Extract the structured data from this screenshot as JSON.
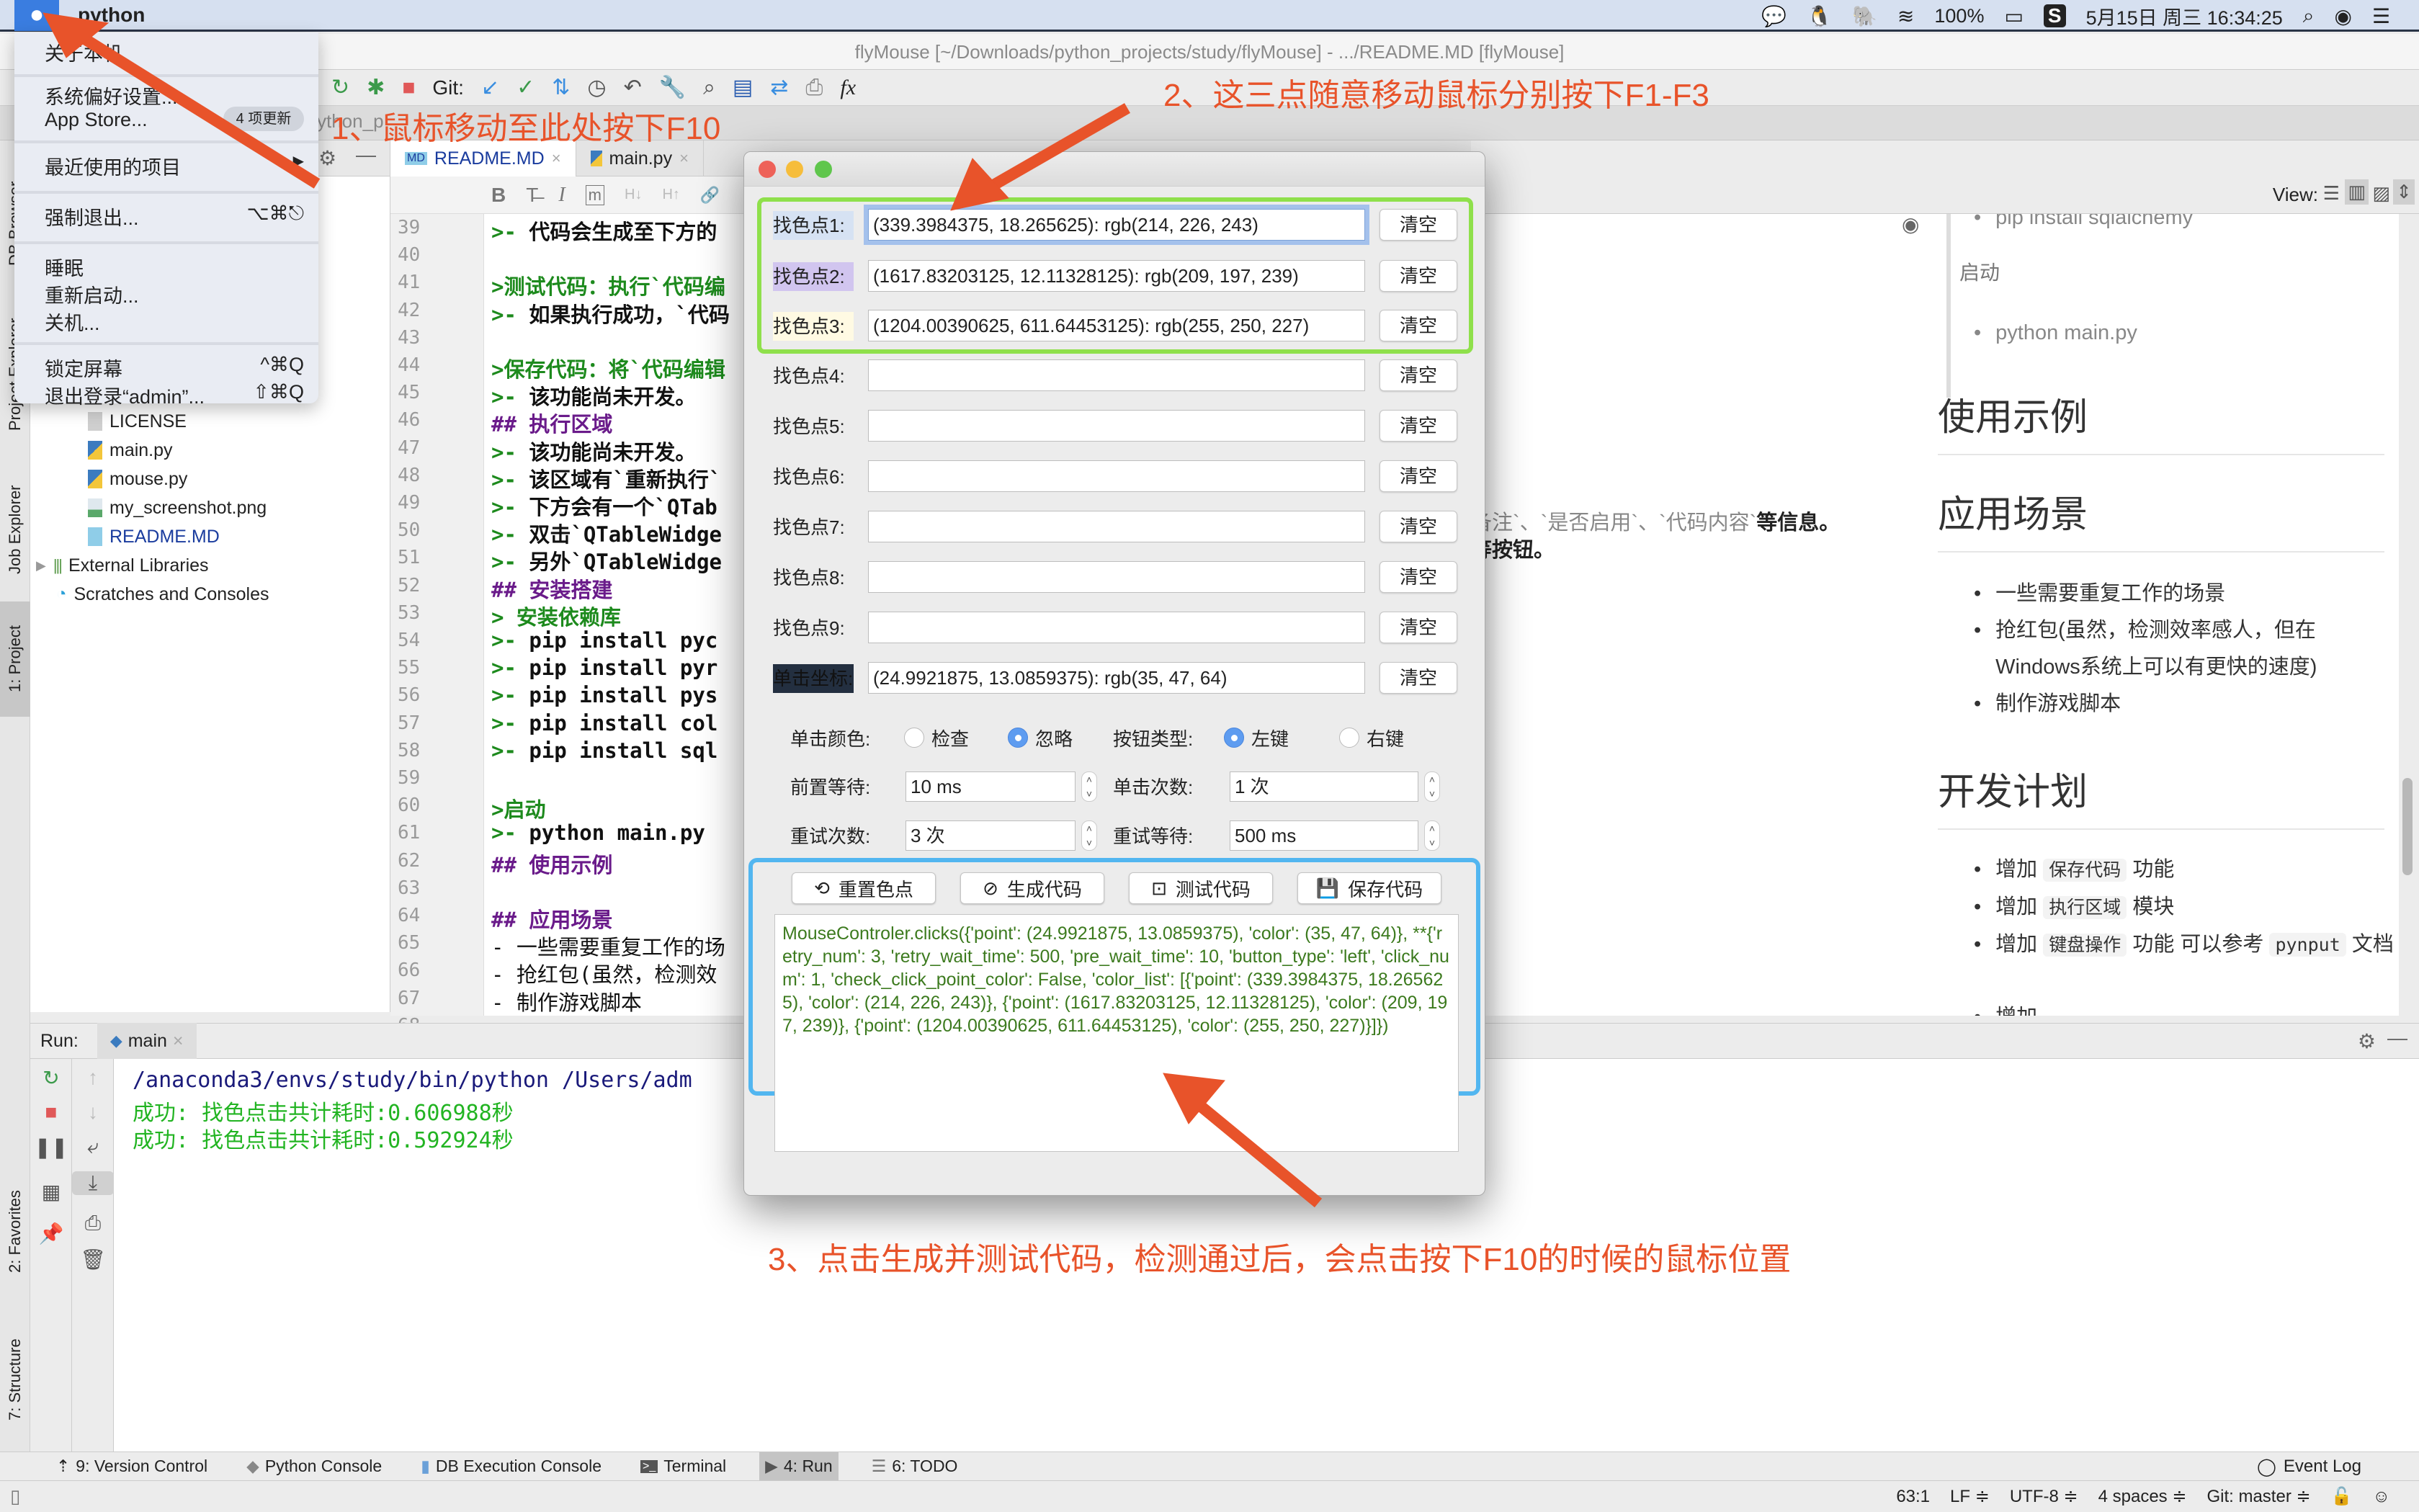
{
  "menubar": {
    "app_name": "python",
    "battery": "100%",
    "datetime": "5月15日 周三 16:34:25",
    "icons": [
      "wechat-icon",
      "qq-icon",
      "evernote-icon",
      "wifi-icon",
      "battery-icon",
      "s-app-icon",
      "search-icon",
      "siri-icon",
      "list-icon"
    ]
  },
  "apple_menu": {
    "items": [
      {
        "label": "关于本机"
      },
      {
        "label": "系统偏好设置..."
      },
      {
        "label": "App Store...",
        "badge": "4 项更新"
      },
      {
        "label": "最近使用的项目",
        "submenu": "▶"
      },
      {
        "label": "强制退出...",
        "shortcut": "⌥⌘⎋"
      },
      {
        "label": "睡眠"
      },
      {
        "label": "重新启动..."
      },
      {
        "label": "关机..."
      },
      {
        "label": "锁定屏幕",
        "shortcut": "^⌘Q"
      },
      {
        "label": "退出登录“admin”...",
        "shortcut": "⇧⌘Q"
      }
    ]
  },
  "window": {
    "title": "flyMouse [~/Downloads/python_projects/study/flyMouse] - .../README.MD [flyMouse]"
  },
  "toolbar": {
    "git_label": "Git:",
    "nav_fragment": "ython_p"
  },
  "left_strip": [
    "DB Browser",
    "Project Explorer",
    "Job Explorer",
    "1: Project",
    "2: Favorites",
    "7: Structure"
  ],
  "project_tree": {
    "files": [
      "LICENSE",
      "main.py",
      "mouse.py",
      "my_screenshot.png",
      "README.MD"
    ],
    "external": "External Libraries",
    "scratches": "Scratches and Consoles"
  },
  "editor": {
    "tabs": [
      {
        "label": "README.MD",
        "active": true
      },
      {
        "label": "main.py",
        "active": false
      }
    ],
    "md_tools": [
      "B",
      "T̶",
      "I",
      "m",
      "H↓",
      "H↑",
      "🔗"
    ],
    "line_numbers": [
      "39",
      "40",
      "41",
      "42",
      "43",
      "44",
      "45",
      "46",
      "47",
      "48",
      "49",
      "50",
      "51",
      "52",
      "53",
      "54",
      "55",
      "56",
      "57",
      "58",
      "59",
      "60",
      "61",
      "62",
      "63",
      "64",
      "65",
      "66",
      "67",
      "68"
    ],
    "lines": [
      {
        "m": ">- ",
        "t": "代码会生成至下方的",
        "c": "b"
      },
      {
        "m": "",
        "t": "",
        "c": "b"
      },
      {
        "m": ">测试代码：执行",
        "t": "`代码编",
        "c": "g"
      },
      {
        "m": ">- ",
        "t": "如果执行成功，`代码",
        "c": "b"
      },
      {
        "m": "",
        "t": "",
        "c": "b"
      },
      {
        "m": ">保存代码：将",
        "t": "`代码编辑",
        "c": "g"
      },
      {
        "m": ">- ",
        "t": "该功能尚未开发。",
        "c": "b"
      },
      {
        "m": "## ",
        "t": "执行区域",
        "c": "p"
      },
      {
        "m": ">- ",
        "t": "该功能尚未开发。",
        "c": "b"
      },
      {
        "m": ">- ",
        "t": "该区域有`重新执行`",
        "c": "b"
      },
      {
        "m": ">- ",
        "t": "下方会有一个`QTab",
        "c": "b"
      },
      {
        "m": ">- ",
        "t": "双击`QTableWidge",
        "c": "b"
      },
      {
        "m": ">- ",
        "t": "另外`QTableWidge",
        "c": "b"
      },
      {
        "m": "## ",
        "t": "安装搭建",
        "c": "p"
      },
      {
        "m": "> ",
        "t": "安装依赖库",
        "c": "g"
      },
      {
        "m": ">- ",
        "t": "pip install pyc",
        "c": "b"
      },
      {
        "m": ">- ",
        "t": "pip install pyr",
        "c": "b"
      },
      {
        "m": ">- ",
        "t": "pip install pys",
        "c": "b"
      },
      {
        "m": ">- ",
        "t": "pip install col",
        "c": "b"
      },
      {
        "m": ">- ",
        "t": "pip install sql",
        "c": "b"
      },
      {
        "m": "",
        "t": "",
        "c": "b"
      },
      {
        "m": ">启动",
        "t": "",
        "c": "g"
      },
      {
        "m": ">- ",
        "t": "python main.py",
        "c": "b"
      },
      {
        "m": "## ",
        "t": "使用示例",
        "c": "p"
      },
      {
        "m": "",
        "t": "",
        "c": "b"
      },
      {
        "m": "## ",
        "t": "应用场景",
        "c": "p"
      },
      {
        "m": "- ",
        "t": "一些需要重复工作的场",
        "c": "n"
      },
      {
        "m": "- ",
        "t": "抢红包(虽然，检测效",
        "c": "n"
      },
      {
        "m": "- ",
        "t": "制作游戏脚本",
        "c": "n"
      },
      {
        "m": "## ",
        "t": "开发计划",
        "c": "p"
      }
    ],
    "overflow_line_50": "备注`、`是否启用`、`代码内容`",
    "overflow_line_50_bold": "等信息。",
    "overflow_line_51": "等按钮。"
  },
  "preview": {
    "view_label": "View:",
    "items": [
      {
        "type": "bullet",
        "text": "pip install sqlalchemy"
      },
      {
        "type": "quote",
        "text": "启动"
      },
      {
        "type": "bullet",
        "text": "python main.py"
      },
      {
        "type": "h",
        "text": "使用示例"
      },
      {
        "type": "h",
        "text": "应用场景"
      },
      {
        "type": "bullet",
        "text": "一些需要重复工作的场景"
      },
      {
        "type": "bullet",
        "text": "抢红包(虽然，检测效率感人，但在Windows系统上可以有更快的速度)"
      },
      {
        "type": "bullet",
        "text": "制作游戏脚本"
      },
      {
        "type": "h",
        "text": "开发计划"
      }
    ],
    "plan": [
      {
        "pre": "增加",
        "chip": "保存代码",
        "post": "功能"
      },
      {
        "pre": "增加",
        "chip": "执行区域",
        "post": "模块"
      },
      {
        "pre": "增加",
        "chip": "键盘操作",
        "post": "功能 可以参考",
        "chip2": "pynput",
        "post2": "文档"
      },
      {
        "pre": "增加",
        "chip": "",
        "post": ""
      }
    ]
  },
  "dialog": {
    "color_points": [
      {
        "label": "找色点1:",
        "value": "(339.3984375, 18.265625): rgb(214, 226, 243)",
        "swatch": "#d6e2f3"
      },
      {
        "label": "找色点2:",
        "value": "(1617.83203125, 12.11328125): rgb(209, 197, 239)",
        "swatch": "#d1c5ef"
      },
      {
        "label": "找色点3:",
        "value": "(1204.00390625, 611.64453125): rgb(255, 250, 227)",
        "swatch": "#fffae3"
      },
      {
        "label": "找色点4:",
        "value": ""
      },
      {
        "label": "找色点5:",
        "value": ""
      },
      {
        "label": "找色点6:",
        "value": ""
      },
      {
        "label": "找色点7:",
        "value": ""
      },
      {
        "label": "找色点8:",
        "value": ""
      },
      {
        "label": "找色点9:",
        "value": ""
      },
      {
        "label": "单击坐标:",
        "value": "(24.9921875, 13.0859375): rgb(35, 47, 64)",
        "swatch": "#232f40"
      }
    ],
    "clear_label": "清空",
    "click_color_label": "单击颜色:",
    "click_color_options": [
      {
        "label": "检查",
        "checked": false
      },
      {
        "label": "忽略",
        "checked": true
      }
    ],
    "button_type_label": "按钮类型:",
    "button_type_options": [
      {
        "label": "左键",
        "checked": true
      },
      {
        "label": "右键",
        "checked": false
      }
    ],
    "pre_wait_label": "前置等待:",
    "pre_wait_value": "10 ms",
    "click_num_label": "单击次数:",
    "click_num_value": "1 次",
    "retry_num_label": "重试次数:",
    "retry_num_value": "3 次",
    "retry_wait_label": "重试等待:",
    "retry_wait_value": "500 ms",
    "actions": [
      {
        "label": "重置色点",
        "icon": "reset-icon"
      },
      {
        "label": "生成代码",
        "icon": "code-icon"
      },
      {
        "label": "测试代码",
        "icon": "terminal-icon"
      },
      {
        "label": "保存代码",
        "icon": "save-icon"
      }
    ],
    "code_output": "MouseControler.clicks({'point': (24.9921875, 13.0859375), 'color': (35, 47, 64)}, **{'retry_num': 3, 'retry_wait_time': 500, 'pre_wait_time': 10, 'button_type': 'left', 'click_num': 1, 'check_click_point_color': False, 'color_list': [{'point': (339.3984375, 18.265625), 'color': (214, 226, 243)}, {'point': (1617.83203125, 12.11328125), 'color': (209, 197, 239)}, {'point': (1204.00390625, 611.64453125), 'color': (255, 250, 227)}]})"
  },
  "run": {
    "label": "Run:",
    "tab": "main",
    "lines": [
      {
        "text": "/anaconda3/envs/study/bin/python /Users/adm",
        "color": "#1a1a7a"
      },
      {
        "text": " 成功: 找色点击共计耗时:0.606988秒",
        "color": "#22b422"
      },
      {
        "text": " 成功: 找色点击共计耗时:0.592924秒",
        "color": "#22b422"
      }
    ]
  },
  "tool_windows": [
    {
      "label": "9: Version Control",
      "active": false
    },
    {
      "label": "Python Console",
      "active": false
    },
    {
      "label": "DB Execution Console",
      "active": false
    },
    {
      "label": "Terminal",
      "active": false
    },
    {
      "label": "4: Run",
      "active": true
    },
    {
      "label": "6: TODO",
      "active": false
    }
  ],
  "event_log": "Event Log",
  "status": {
    "position": "63:1",
    "line_sep": "LF ≑",
    "encoding": "UTF-8 ≑",
    "indent": "4 spaces ≑",
    "git": "Git: master ≑"
  },
  "annotations": {
    "step1": "1、鼠标移动至此处按下F10",
    "step2": "2、这三点随意移动鼠标分别按下F1-F3",
    "step3": "3、点击生成并测试代码，检测通过后，会点击按下F10的时候的鼠标位置",
    "color": "#e8532a"
  }
}
